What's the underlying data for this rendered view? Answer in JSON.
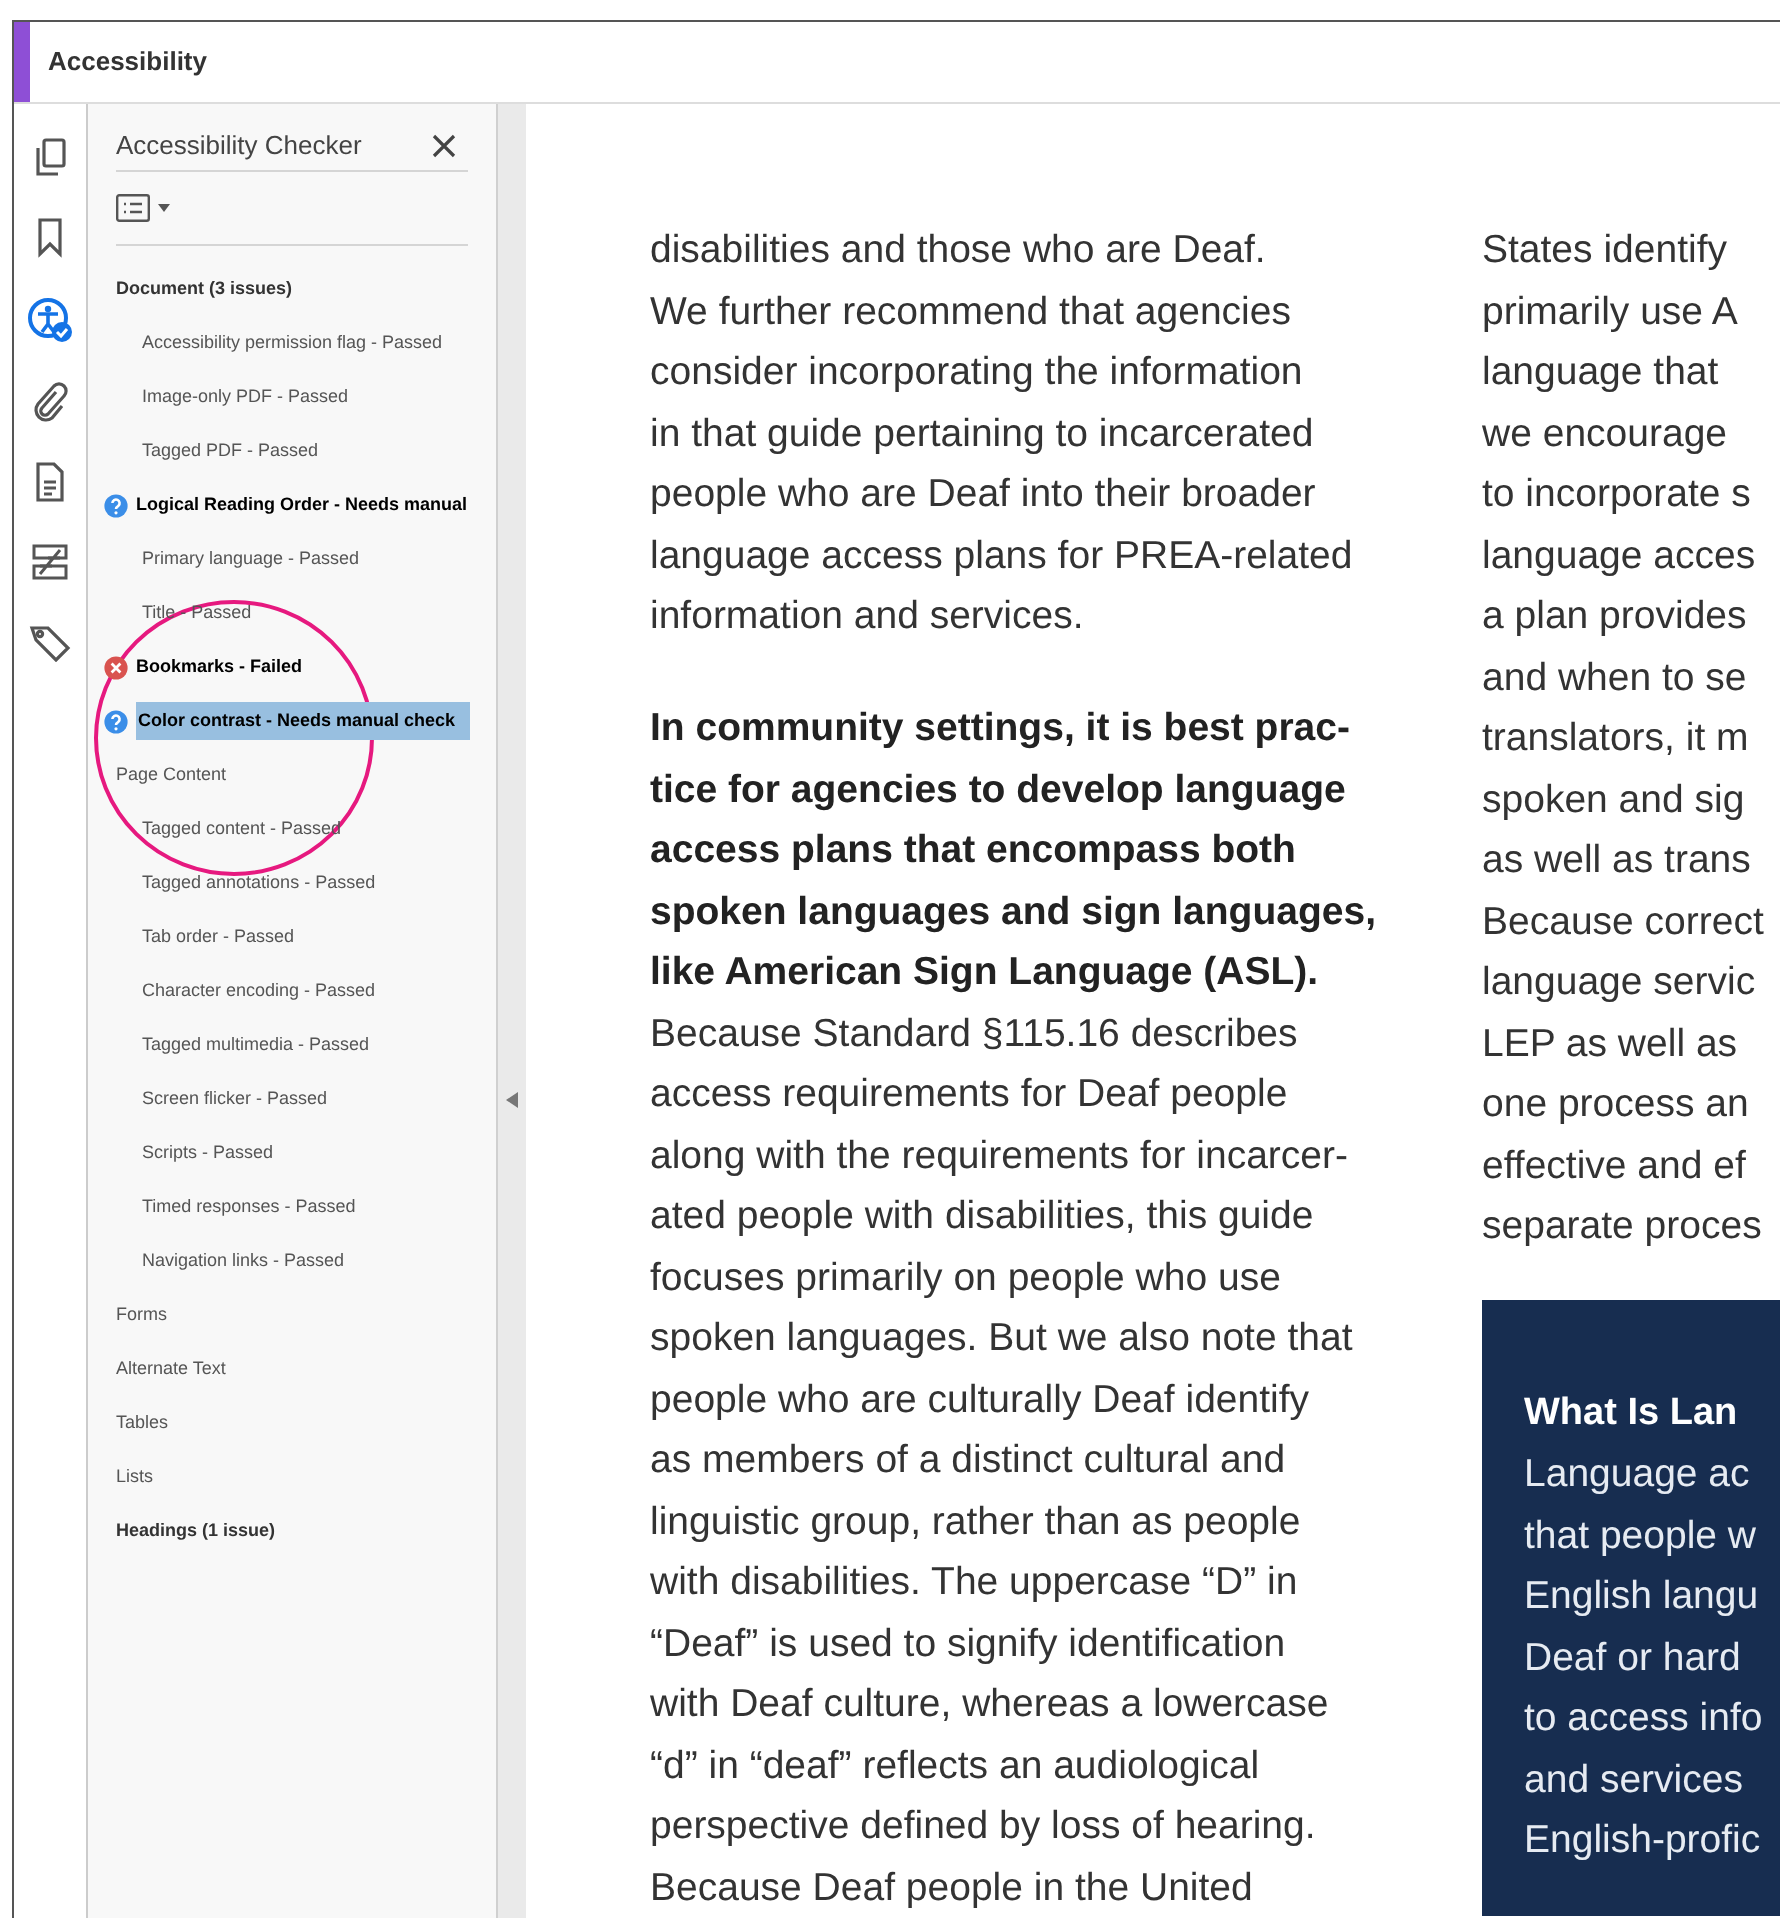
{
  "window": {
    "title": "Accessibility"
  },
  "panel": {
    "title": "Accessibility Checker",
    "groups": [
      {
        "label": "Document (3 issues)",
        "has_issues": true,
        "children": [
          {
            "label": "Accessibility permission flag - Passed",
            "kind": "passed",
            "selected": false
          },
          {
            "label": "Image-only PDF - Passed",
            "kind": "passed",
            "selected": false
          },
          {
            "label": "Tagged PDF - Passed",
            "kind": "passed",
            "selected": false
          },
          {
            "label": "Logical Reading Order - Needs manual",
            "kind": "manual",
            "selected": false
          },
          {
            "label": "Primary language - Passed",
            "kind": "passed",
            "selected": false
          },
          {
            "label": "Title - Passed",
            "kind": "passed",
            "selected": false
          },
          {
            "label": "Bookmarks - Failed",
            "kind": "failed",
            "selected": false
          },
          {
            "label": "Color contrast - Needs manual check",
            "kind": "manual",
            "selected": true
          }
        ]
      },
      {
        "label": "Page Content",
        "has_issues": false,
        "children": [
          {
            "label": "Tagged content - Passed",
            "kind": "passed",
            "selected": false
          },
          {
            "label": "Tagged annotations - Passed",
            "kind": "passed",
            "selected": false
          },
          {
            "label": "Tab order - Passed",
            "kind": "passed",
            "selected": false
          },
          {
            "label": "Character encoding - Passed",
            "kind": "passed",
            "selected": false
          },
          {
            "label": "Tagged multimedia - Passed",
            "kind": "passed",
            "selected": false
          },
          {
            "label": "Screen flicker - Passed",
            "kind": "passed",
            "selected": false
          },
          {
            "label": "Scripts - Passed",
            "kind": "passed",
            "selected": false
          },
          {
            "label": "Timed responses - Passed",
            "kind": "passed",
            "selected": false
          },
          {
            "label": "Navigation links - Passed",
            "kind": "passed",
            "selected": false
          }
        ]
      },
      {
        "label": "Forms",
        "has_issues": false
      },
      {
        "label": "Alternate Text",
        "has_issues": false
      },
      {
        "label": "Tables",
        "has_issues": false
      },
      {
        "label": "Lists",
        "has_issues": false
      },
      {
        "label": "Headings (1 issue)",
        "has_issues": true
      }
    ]
  },
  "document": {
    "left_column": [
      {
        "text": "disabilities and those who are Deaf.",
        "kind": "regular"
      },
      {
        "text": "We further recommend that agencies",
        "kind": "regular"
      },
      {
        "text": "consider incorporating the information",
        "kind": "regular"
      },
      {
        "text": "in that guide pertaining to incarcerated",
        "kind": "regular"
      },
      {
        "text": "people who are Deaf into their broader",
        "kind": "regular"
      },
      {
        "text": "language access plans for PREA-related",
        "kind": "regular"
      },
      {
        "text": "information and services.",
        "kind": "regular"
      },
      {
        "kind": "gap"
      },
      {
        "text": "In community settings, it is best prac-",
        "kind": "bold"
      },
      {
        "text": "tice for agencies to develop language",
        "kind": "bold"
      },
      {
        "text": "access plans that encompass both",
        "kind": "bold"
      },
      {
        "text": "spoken languages and sign languages,",
        "kind": "bold"
      },
      {
        "text": "like American Sign Language (ASL).",
        "kind": "bold"
      },
      {
        "text": "Because Standard §115.16 describes",
        "kind": "regular"
      },
      {
        "text": "access requirements for Deaf people",
        "kind": "regular"
      },
      {
        "text": "along with the requirements for incarcer-",
        "kind": "regular"
      },
      {
        "text": "ated people with disabilities, this guide",
        "kind": "regular"
      },
      {
        "text": "focuses primarily on people who use",
        "kind": "regular"
      },
      {
        "text": "spoken languages. But we also note that",
        "kind": "regular"
      },
      {
        "text": "people who are culturally Deaf identify",
        "kind": "regular"
      },
      {
        "text": "as members of a distinct cultural and",
        "kind": "regular"
      },
      {
        "text": "linguistic group, rather than as people",
        "kind": "regular"
      },
      {
        "text": "with disabilities. The uppercase “D” in",
        "kind": "regular"
      },
      {
        "text": "“Deaf” is used to signify identification",
        "kind": "regular"
      },
      {
        "text": "with Deaf culture, whereas a lowercase",
        "kind": "regular"
      },
      {
        "text": "“d” in “deaf” reflects an audiological",
        "kind": "regular"
      },
      {
        "text": "perspective defined by loss of hearing.",
        "kind": "regular"
      },
      {
        "text": "Because Deaf people in the United",
        "kind": "regular"
      }
    ],
    "right_column": [
      "States identify",
      "primarily use A",
      "language that",
      "we encourage",
      "to incorporate s",
      "language acces",
      "a plan provides",
      "and when to se",
      "translators, it m",
      "spoken and sig",
      "as well as trans",
      "Because correct",
      "language servic",
      "LEP as well as",
      "one process an",
      "effective and ef",
      "separate proces"
    ],
    "sidebar_box": {
      "heading": "What Is Lan",
      "lines": [
        "Language ac",
        "that people w",
        "English langu",
        "Deaf or hard",
        "to access info",
        "and services",
        "English-profic"
      ]
    }
  }
}
